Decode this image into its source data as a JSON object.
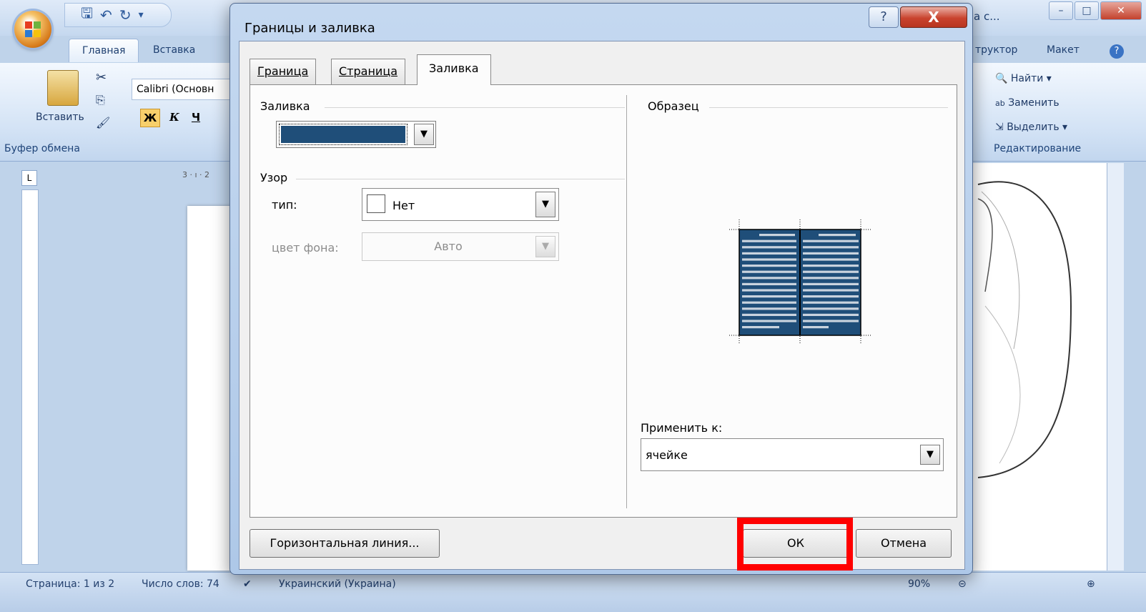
{
  "word": {
    "qat_icons": [
      "save-icon",
      "undo-icon",
      "redo-icon",
      "customize-icon"
    ],
    "title_fragment": "а с...",
    "tabs": [
      "Главная",
      "Вставка",
      "труктор",
      "Макет"
    ],
    "ribbon": {
      "paste_label": "Вставить",
      "font_name": "Calibri (Основн",
      "bold": "Ж",
      "italic": "К",
      "underline": "Ч",
      "clipboard_group": "Буфер обмена",
      "find": "Найти",
      "replace": "Заменить",
      "select": "Выделить",
      "editing_group": "Редактирование"
    },
    "ruler_fragment": "3 · ı · 2",
    "status": {
      "page": "Страница: 1 из 2",
      "words": "Число слов: 74",
      "language": "Украинский (Украина)",
      "zoom": "90%"
    }
  },
  "dialog": {
    "title": "Границы и заливка",
    "help_label": "?",
    "close_label": "X",
    "tabs": [
      {
        "label": "Граница",
        "active": false
      },
      {
        "label": "Страница",
        "active": false
      },
      {
        "label": "Заливка",
        "active": true
      }
    ],
    "fill": {
      "section_label": "Заливка",
      "color": "#1f4e79"
    },
    "pattern": {
      "section_label": "Узор",
      "type_label": "тип:",
      "type_value": "Нет",
      "bg_label": "цвет фона:",
      "bg_value": "Авто"
    },
    "preview": {
      "section_label": "Образец",
      "apply_label": "Применить к:",
      "apply_value": "ячейке"
    },
    "buttons": {
      "horizontal_line": "Горизонтальная линия...",
      "ok": "ОК",
      "cancel": "Отмена"
    },
    "highlight_color": "#ff0000"
  }
}
